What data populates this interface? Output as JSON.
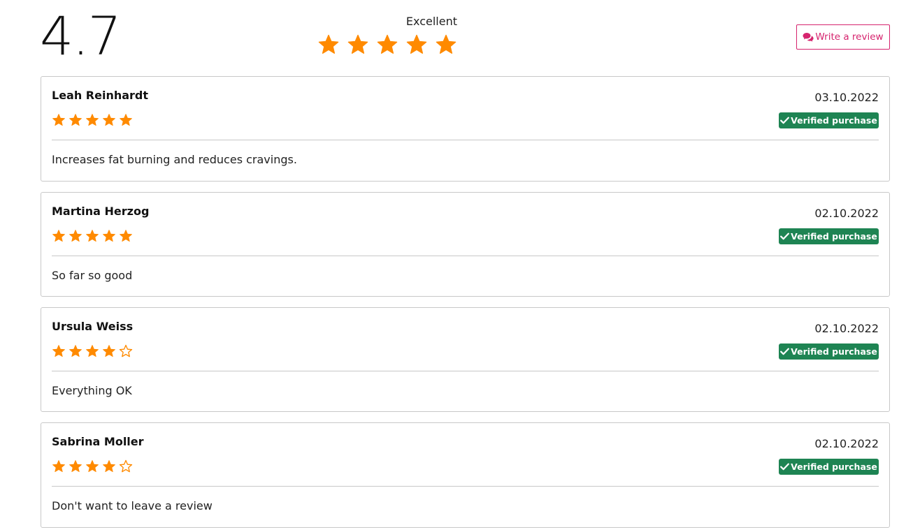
{
  "summary": {
    "score": "4.7",
    "rating_word": "Excellent",
    "stars_filled": 5,
    "stars_total": 5,
    "write_review_label": "Write a review"
  },
  "colors": {
    "star": "#ff8a00",
    "accent": "#d6246e",
    "verified": "#1e8453"
  },
  "icons": {
    "star": "star-icon",
    "star_outline": "star-outline-icon",
    "comments": "comments-icon",
    "check": "check-icon"
  },
  "reviews": [
    {
      "name": "Leah Reinhardt",
      "date": "03.10.2022",
      "rating": 5,
      "verified_label": "Verified purchase",
      "text": "Increases fat burning and reduces cravings."
    },
    {
      "name": "Martina Herzog",
      "date": "02.10.2022",
      "rating": 5,
      "verified_label": "Verified purchase",
      "text": "So far so good"
    },
    {
      "name": "Ursula Weiss",
      "date": "02.10.2022",
      "rating": 4,
      "verified_label": "Verified purchase",
      "text": "Everything OK"
    },
    {
      "name": "Sabrina Moller",
      "date": "02.10.2022",
      "rating": 4,
      "verified_label": "Verified purchase",
      "text": "Don't want to leave a review"
    }
  ]
}
